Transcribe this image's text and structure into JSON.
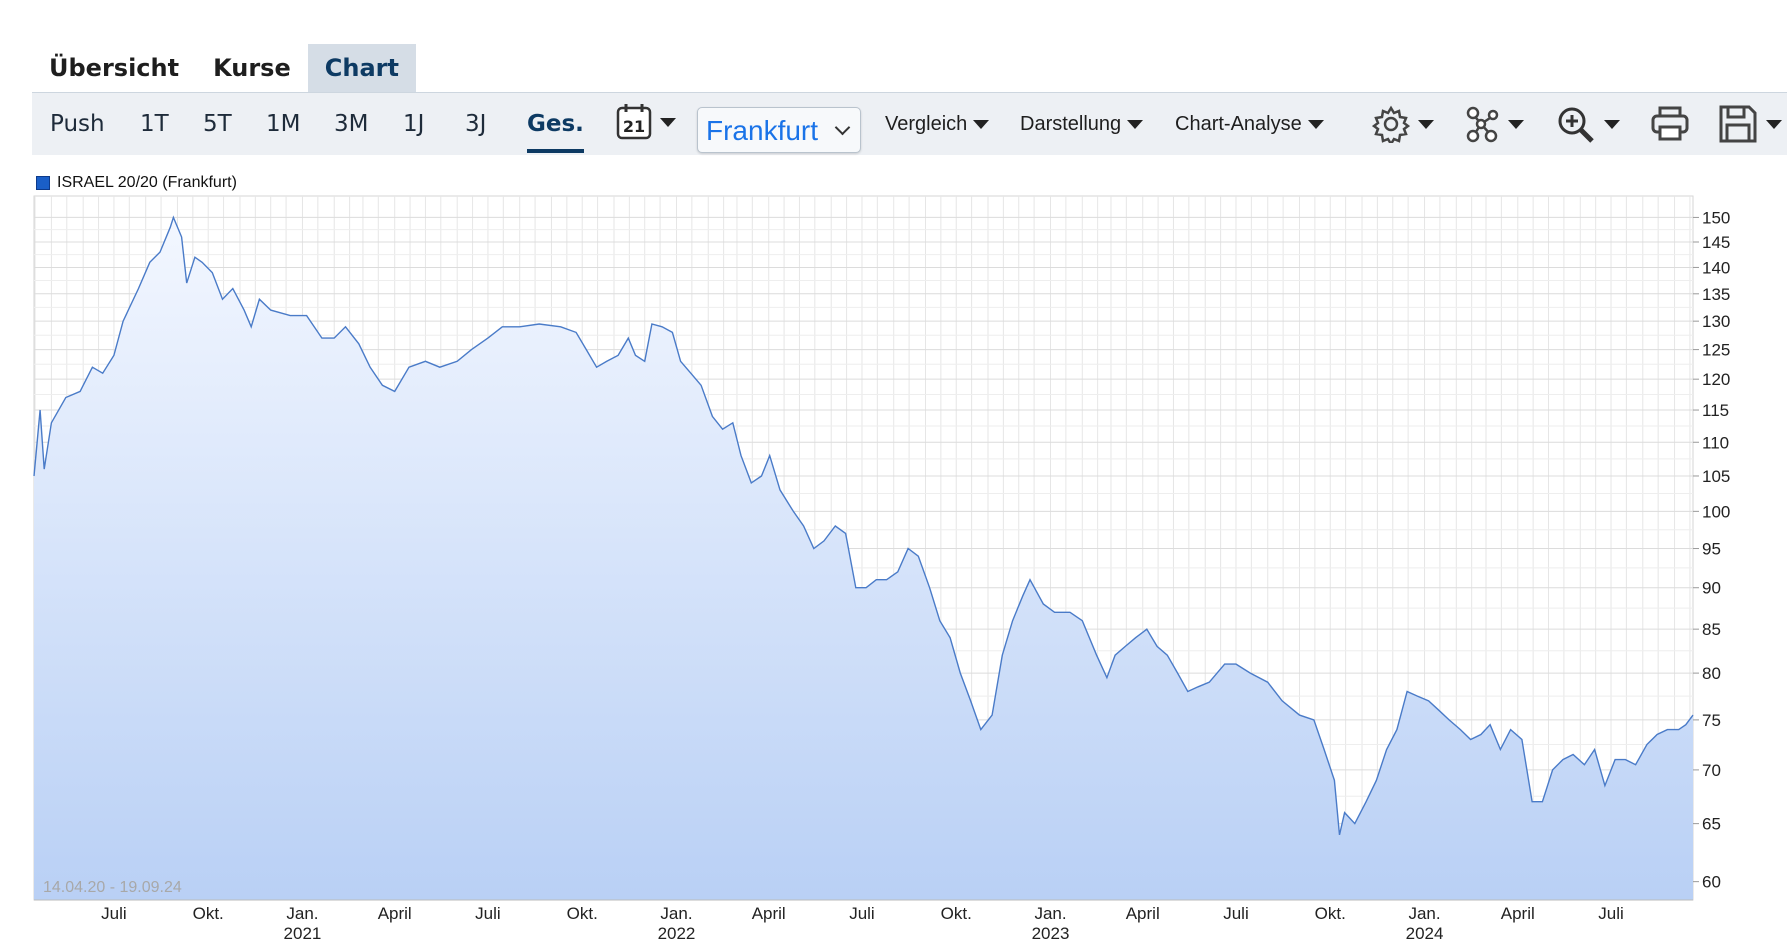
{
  "tabs": [
    {
      "label": "Übersicht",
      "active": false
    },
    {
      "label": "Kurse",
      "active": false
    },
    {
      "label": "Chart",
      "active": true
    }
  ],
  "periods": [
    {
      "label": "Push",
      "active": false
    },
    {
      "label": "1T",
      "active": false
    },
    {
      "label": "5T",
      "active": false
    },
    {
      "label": "1M",
      "active": false
    },
    {
      "label": "3M",
      "active": false
    },
    {
      "label": "1J",
      "active": false
    },
    {
      "label": "3J",
      "active": false
    },
    {
      "label": "Ges.",
      "active": true
    }
  ],
  "toolbar": {
    "calendar_day": "21",
    "exchange": "Frankfurt",
    "menus": [
      "Vergleich",
      "Darstellung",
      "Chart-Analyse"
    ],
    "icons": [
      "gear-icon",
      "network-icon",
      "zoom-in-icon",
      "print-icon",
      "save-icon"
    ]
  },
  "chart_data": {
    "type": "area",
    "series": [
      {
        "name": "ISRAEL 20/20 (Frankfurt)",
        "color": "#4a7bc8",
        "points": [
          [
            "2020-04-14",
            105
          ],
          [
            "2020-04-20",
            115
          ],
          [
            "2020-04-24",
            106
          ],
          [
            "2020-05-01",
            113
          ],
          [
            "2020-05-15",
            117
          ],
          [
            "2020-05-29",
            118
          ],
          [
            "2020-06-10",
            122
          ],
          [
            "2020-06-20",
            121
          ],
          [
            "2020-07-01",
            124
          ],
          [
            "2020-07-10",
            130
          ],
          [
            "2020-07-25",
            136
          ],
          [
            "2020-08-05",
            141
          ],
          [
            "2020-08-15",
            143
          ],
          [
            "2020-08-25",
            148
          ],
          [
            "2020-08-28",
            150
          ],
          [
            "2020-09-05",
            146
          ],
          [
            "2020-09-10",
            137
          ],
          [
            "2020-09-18",
            142
          ],
          [
            "2020-09-25",
            141
          ],
          [
            "2020-10-05",
            139
          ],
          [
            "2020-10-15",
            134
          ],
          [
            "2020-10-25",
            136
          ],
          [
            "2020-11-05",
            132
          ],
          [
            "2020-11-12",
            129
          ],
          [
            "2020-11-20",
            134
          ],
          [
            "2020-12-01",
            132
          ],
          [
            "2020-12-20",
            131
          ],
          [
            "2021-01-05",
            131
          ],
          [
            "2021-01-20",
            127
          ],
          [
            "2021-02-01",
            127
          ],
          [
            "2021-02-12",
            129
          ],
          [
            "2021-02-25",
            126
          ],
          [
            "2021-03-08",
            122
          ],
          [
            "2021-03-20",
            119
          ],
          [
            "2021-04-01",
            118
          ],
          [
            "2021-04-15",
            122
          ],
          [
            "2021-05-01",
            123
          ],
          [
            "2021-05-15",
            122
          ],
          [
            "2021-06-01",
            123
          ],
          [
            "2021-06-15",
            125
          ],
          [
            "2021-07-01",
            127
          ],
          [
            "2021-07-15",
            129
          ],
          [
            "2021-08-01",
            129
          ],
          [
            "2021-08-20",
            129.5
          ],
          [
            "2021-09-10",
            129
          ],
          [
            "2021-09-25",
            128
          ],
          [
            "2021-10-05",
            125
          ],
          [
            "2021-10-15",
            122
          ],
          [
            "2021-10-25",
            123
          ],
          [
            "2021-11-05",
            124
          ],
          [
            "2021-11-15",
            127
          ],
          [
            "2021-11-22",
            124
          ],
          [
            "2021-12-01",
            123
          ],
          [
            "2021-12-08",
            129.5
          ],
          [
            "2021-12-18",
            129
          ],
          [
            "2021-12-28",
            128
          ],
          [
            "2022-01-05",
            123
          ],
          [
            "2022-01-15",
            121
          ],
          [
            "2022-01-25",
            119
          ],
          [
            "2022-02-05",
            114
          ],
          [
            "2022-02-15",
            112
          ],
          [
            "2022-02-25",
            113
          ],
          [
            "2022-03-05",
            108
          ],
          [
            "2022-03-15",
            104
          ],
          [
            "2022-03-25",
            105
          ],
          [
            "2022-04-02",
            108
          ],
          [
            "2022-04-12",
            103
          ],
          [
            "2022-04-25",
            100
          ],
          [
            "2022-05-05",
            98
          ],
          [
            "2022-05-15",
            95
          ],
          [
            "2022-05-25",
            96
          ],
          [
            "2022-06-05",
            98
          ],
          [
            "2022-06-15",
            97
          ],
          [
            "2022-06-25",
            90
          ],
          [
            "2022-07-05",
            90
          ],
          [
            "2022-07-15",
            91
          ],
          [
            "2022-07-25",
            91
          ],
          [
            "2022-08-05",
            92
          ],
          [
            "2022-08-15",
            95
          ],
          [
            "2022-08-25",
            94
          ],
          [
            "2022-09-05",
            90
          ],
          [
            "2022-09-15",
            86
          ],
          [
            "2022-09-25",
            84
          ],
          [
            "2022-10-05",
            80
          ],
          [
            "2022-10-15",
            77
          ],
          [
            "2022-10-25",
            74
          ],
          [
            "2022-11-05",
            75.5
          ],
          [
            "2022-11-15",
            82
          ],
          [
            "2022-11-25",
            86
          ],
          [
            "2022-12-05",
            89
          ],
          [
            "2022-12-12",
            91
          ],
          [
            "2022-12-25",
            88
          ],
          [
            "2023-01-05",
            87
          ],
          [
            "2023-01-20",
            87
          ],
          [
            "2023-02-01",
            86
          ],
          [
            "2023-02-15",
            82
          ],
          [
            "2023-02-25",
            79.5
          ],
          [
            "2023-03-05",
            82
          ],
          [
            "2023-03-15",
            83
          ],
          [
            "2023-03-25",
            84
          ],
          [
            "2023-04-05",
            85
          ],
          [
            "2023-04-15",
            83
          ],
          [
            "2023-04-25",
            82
          ],
          [
            "2023-05-05",
            80
          ],
          [
            "2023-05-15",
            78
          ],
          [
            "2023-05-25",
            78.5
          ],
          [
            "2023-06-05",
            79
          ],
          [
            "2023-06-20",
            81
          ],
          [
            "2023-07-01",
            81
          ],
          [
            "2023-07-15",
            80
          ],
          [
            "2023-08-01",
            79
          ],
          [
            "2023-08-15",
            77
          ],
          [
            "2023-09-01",
            75.5
          ],
          [
            "2023-09-15",
            75
          ],
          [
            "2023-09-25",
            72
          ],
          [
            "2023-10-05",
            69
          ],
          [
            "2023-10-10",
            64
          ],
          [
            "2023-10-15",
            66
          ],
          [
            "2023-10-25",
            65
          ],
          [
            "2023-11-05",
            67
          ],
          [
            "2023-11-15",
            69
          ],
          [
            "2023-11-25",
            72
          ],
          [
            "2023-12-05",
            74
          ],
          [
            "2023-12-15",
            78
          ],
          [
            "2023-12-25",
            77.5
          ],
          [
            "2024-01-05",
            77
          ],
          [
            "2024-01-15",
            76
          ],
          [
            "2024-01-25",
            75
          ],
          [
            "2024-02-05",
            74
          ],
          [
            "2024-02-15",
            73
          ],
          [
            "2024-02-25",
            73.5
          ],
          [
            "2024-03-05",
            74.5
          ],
          [
            "2024-03-15",
            72
          ],
          [
            "2024-03-25",
            74
          ],
          [
            "2024-04-05",
            73
          ],
          [
            "2024-04-15",
            67
          ],
          [
            "2024-04-25",
            67
          ],
          [
            "2024-05-05",
            70
          ],
          [
            "2024-05-15",
            71
          ],
          [
            "2024-05-25",
            71.5
          ],
          [
            "2024-06-05",
            70.5
          ],
          [
            "2024-06-15",
            72
          ],
          [
            "2024-06-25",
            68.5
          ],
          [
            "2024-07-05",
            71
          ],
          [
            "2024-07-15",
            71
          ],
          [
            "2024-07-25",
            70.5
          ],
          [
            "2024-08-05",
            72.5
          ],
          [
            "2024-08-15",
            73.5
          ],
          [
            "2024-08-25",
            74
          ],
          [
            "2024-09-05",
            74
          ],
          [
            "2024-09-12",
            74.5
          ],
          [
            "2024-09-19",
            75.5
          ]
        ]
      }
    ],
    "y_ticks": [
      60,
      65,
      70,
      75,
      80,
      85,
      90,
      95,
      100,
      105,
      110,
      115,
      120,
      125,
      130,
      135,
      140,
      145,
      150
    ],
    "y_scale": "log",
    "ylim": [
      58.5,
      154.5
    ],
    "xlim": [
      "2020-04-14",
      "2024-09-19"
    ],
    "x_ticks": [
      {
        "date": "2020-07-01",
        "label": "Juli",
        "year": ""
      },
      {
        "date": "2020-10-01",
        "label": "Okt.",
        "year": ""
      },
      {
        "date": "2021-01-01",
        "label": "Jan.",
        "year": "2021"
      },
      {
        "date": "2021-04-01",
        "label": "April",
        "year": ""
      },
      {
        "date": "2021-07-01",
        "label": "Juli",
        "year": ""
      },
      {
        "date": "2021-10-01",
        "label": "Okt.",
        "year": ""
      },
      {
        "date": "2022-01-01",
        "label": "Jan.",
        "year": "2022"
      },
      {
        "date": "2022-04-01",
        "label": "April",
        "year": ""
      },
      {
        "date": "2022-07-01",
        "label": "Juli",
        "year": ""
      },
      {
        "date": "2022-10-01",
        "label": "Okt.",
        "year": ""
      },
      {
        "date": "2023-01-01",
        "label": "Jan.",
        "year": "2023"
      },
      {
        "date": "2023-04-01",
        "label": "April",
        "year": ""
      },
      {
        "date": "2023-07-01",
        "label": "Juli",
        "year": ""
      },
      {
        "date": "2023-10-01",
        "label": "Okt.",
        "year": ""
      },
      {
        "date": "2024-01-01",
        "label": "Jan.",
        "year": "2024"
      },
      {
        "date": "2024-04-01",
        "label": "April",
        "year": ""
      },
      {
        "date": "2024-07-01",
        "label": "Juli",
        "year": ""
      }
    ],
    "range_label": "14.04.20 - 19.09.24",
    "grid": true,
    "legend": "top-left"
  }
}
